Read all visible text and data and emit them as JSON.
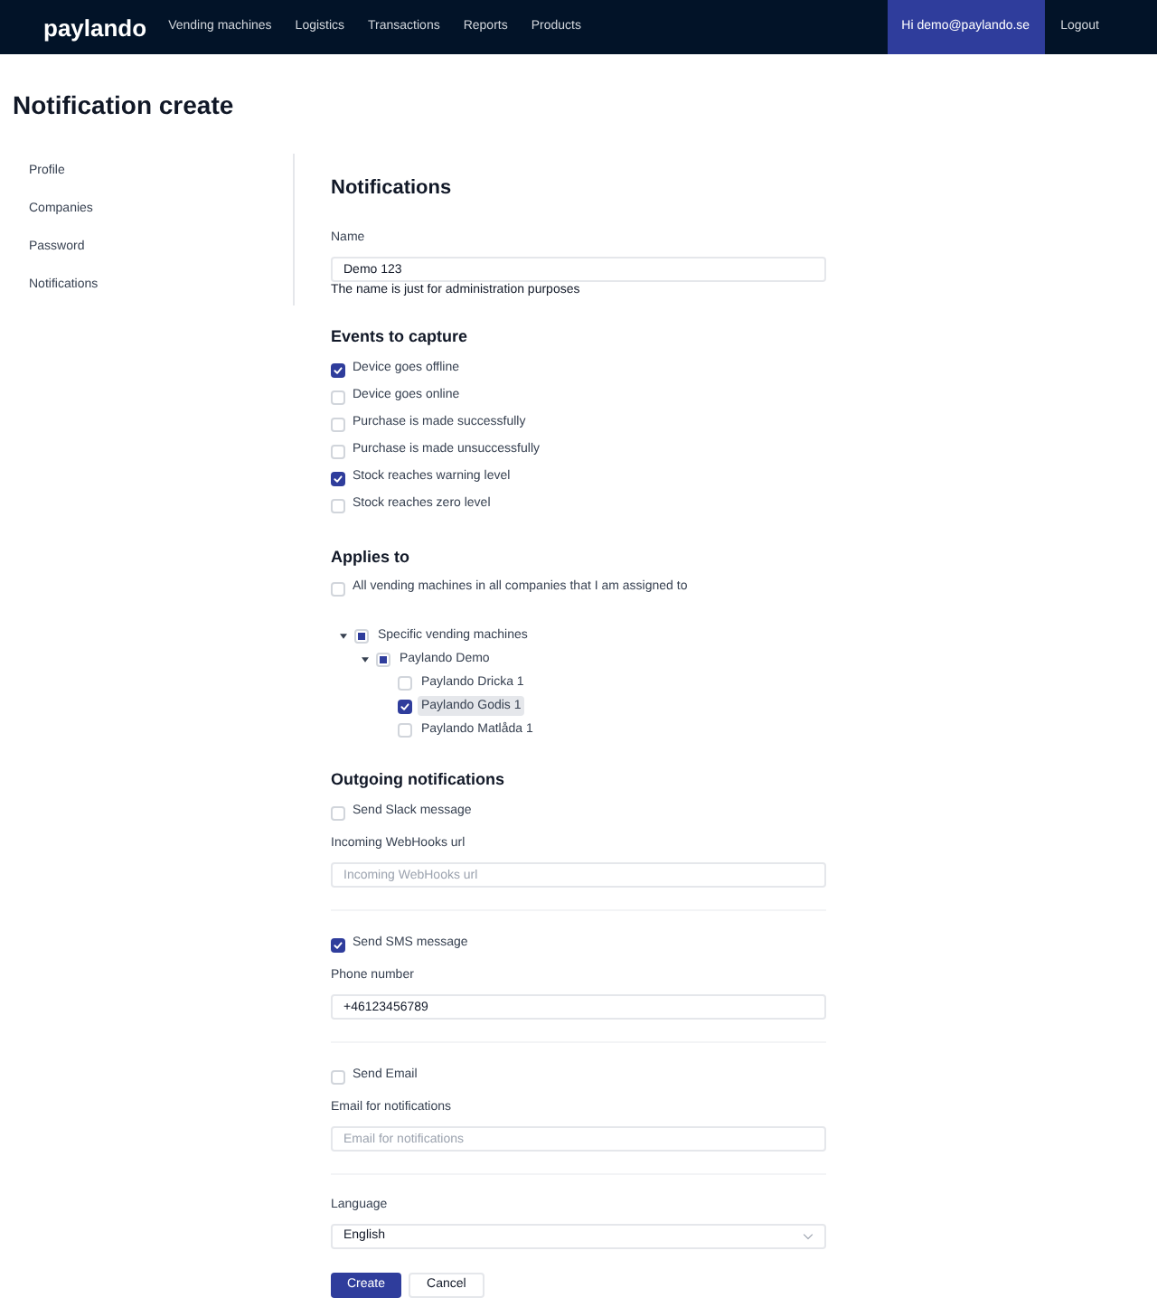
{
  "header": {
    "logo": "paylando",
    "nav": [
      {
        "label": "Vending machines"
      },
      {
        "label": "Logistics"
      },
      {
        "label": "Transactions"
      },
      {
        "label": "Reports"
      },
      {
        "label": "Products"
      }
    ],
    "user": {
      "label": "Hi demo@paylando.se",
      "selected": true
    },
    "logout": "Logout"
  },
  "page_title": "Notification create",
  "sidebar": {
    "items": [
      {
        "label": "Profile"
      },
      {
        "label": "Companies"
      },
      {
        "label": "Password"
      },
      {
        "label": "Notifications"
      }
    ]
  },
  "form": {
    "title": "Notifications",
    "name": {
      "label": "Name",
      "value": "Demo 123",
      "help": "The name is just for administration purposes"
    },
    "events": {
      "title": "Events to capture",
      "options": [
        {
          "label": "Device goes offline",
          "checked": true
        },
        {
          "label": "Device goes online",
          "checked": false
        },
        {
          "label": "Purchase is made successfully",
          "checked": false
        },
        {
          "label": "Purchase is made unsuccessfully",
          "checked": false
        },
        {
          "label": "Stock reaches warning level",
          "checked": true
        },
        {
          "label": "Stock reaches zero level",
          "checked": false
        }
      ]
    },
    "applies_to": {
      "title": "Applies to",
      "all": {
        "label": "All vending machines in all companies that I am assigned to",
        "checked": false
      },
      "tree": [
        {
          "label": "Specific vending machines",
          "indeterminate": true,
          "expanded": true,
          "selected": false,
          "children": [
            {
              "label": "Paylando Demo",
              "indeterminate": true,
              "expanded": true,
              "selected": false,
              "children": [
                {
                  "label": "Paylando Dricka 1",
                  "checked": false,
                  "selected": false
                },
                {
                  "label": "Paylando Godis 1",
                  "checked": true,
                  "selected": true
                },
                {
                  "label": "Paylando Matlåda 1",
                  "checked": false,
                  "selected": false
                }
              ]
            }
          ]
        }
      ]
    },
    "outgoing": {
      "title": "Outgoing notifications",
      "channels": [
        {
          "toggle": {
            "label": "Send Slack message",
            "checked": false
          },
          "field": {
            "label": "Incoming WebHooks url",
            "placeholder": "Incoming WebHooks url"
          }
        },
        {
          "toggle": {
            "label": "Send SMS message",
            "checked": true
          },
          "field": {
            "label": "Phone number",
            "value": "+46123456789"
          }
        },
        {
          "toggle": {
            "label": "Send Email",
            "checked": false
          },
          "field": {
            "label": "Email for notifications",
            "placeholder": "Email for notifications"
          }
        }
      ]
    },
    "language": {
      "label": "Language",
      "value": "English"
    },
    "buttons": [
      {
        "label": "Create",
        "kind": "primary"
      },
      {
        "label": "Cancel",
        "kind": "secondary"
      }
    ]
  }
}
